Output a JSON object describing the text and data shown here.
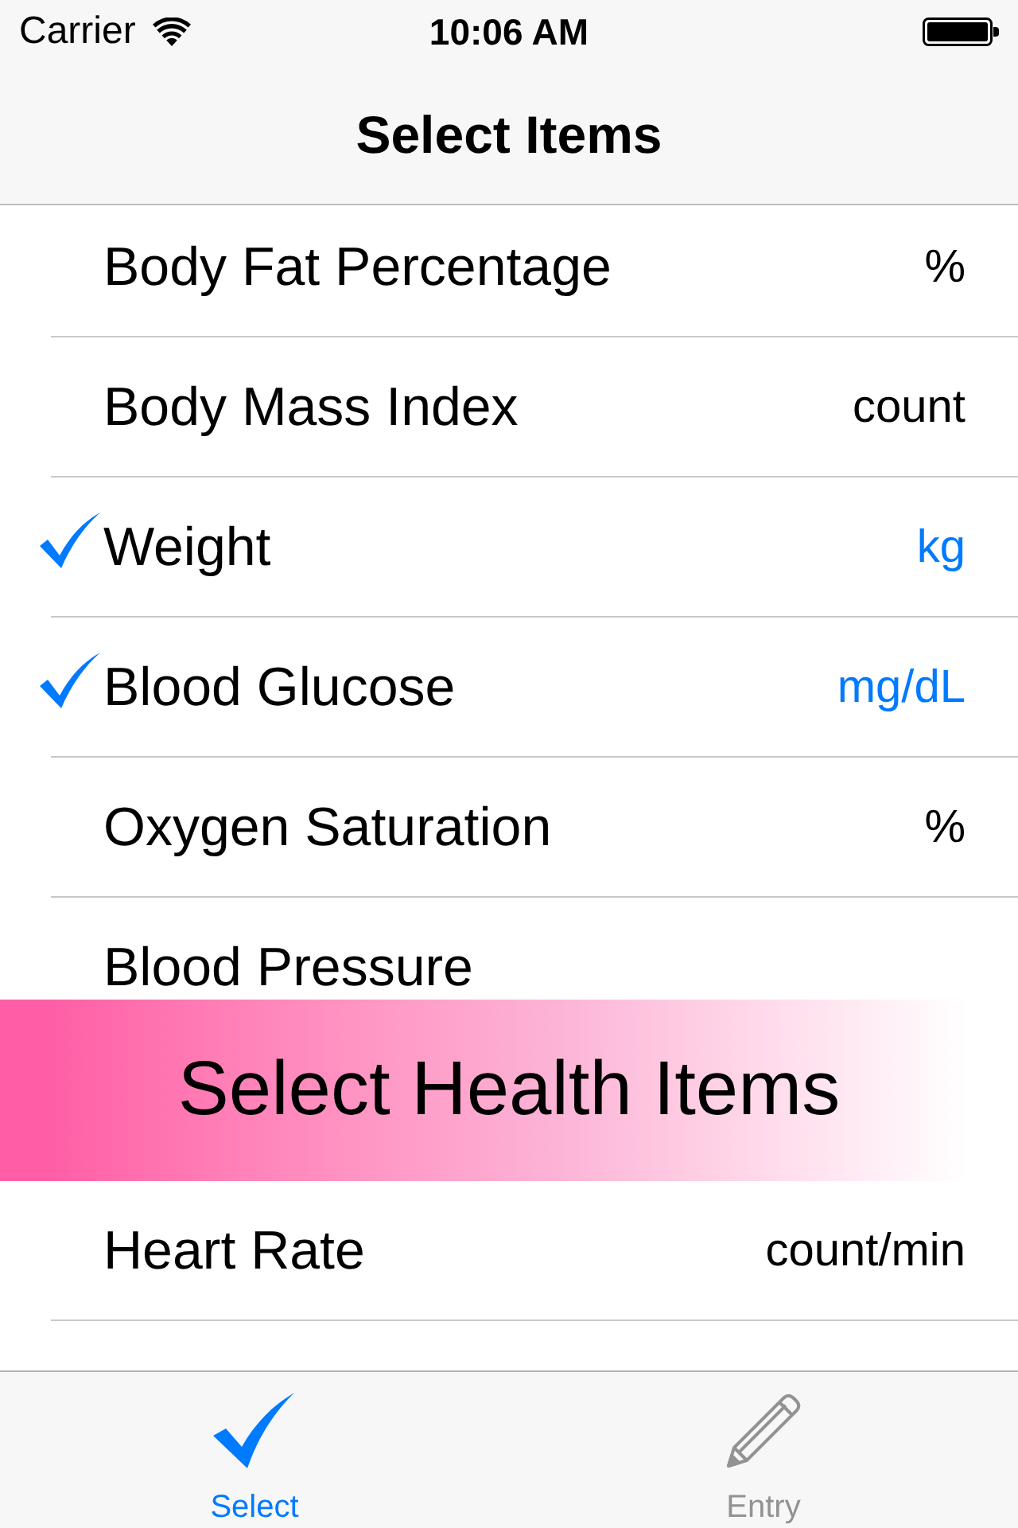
{
  "status_bar": {
    "carrier": "Carrier",
    "time": "10:06 AM"
  },
  "nav_bar": {
    "title": "Select Items"
  },
  "rows": [
    {
      "label": "Body Fat Percentage",
      "unit": "%",
      "checked": false
    },
    {
      "label": "Body Mass Index",
      "unit": "count",
      "checked": false
    },
    {
      "label": "Weight",
      "unit": "kg",
      "checked": true
    },
    {
      "label": "Blood Glucose",
      "unit": "mg/dL",
      "checked": true
    },
    {
      "label": "Oxygen Saturation",
      "unit": "%",
      "checked": false
    },
    {
      "label": "Blood Pressure",
      "checked": false
    }
  ],
  "banner": {
    "text": "Select Health Items"
  },
  "rows_below_banner": [
    {
      "label": "Heart Rate",
      "unit": "count/min",
      "checked": false
    }
  ],
  "tab_bar": {
    "tabs": [
      {
        "label": "Select",
        "selected": true
      },
      {
        "label": "Entry",
        "selected": false
      }
    ]
  }
}
